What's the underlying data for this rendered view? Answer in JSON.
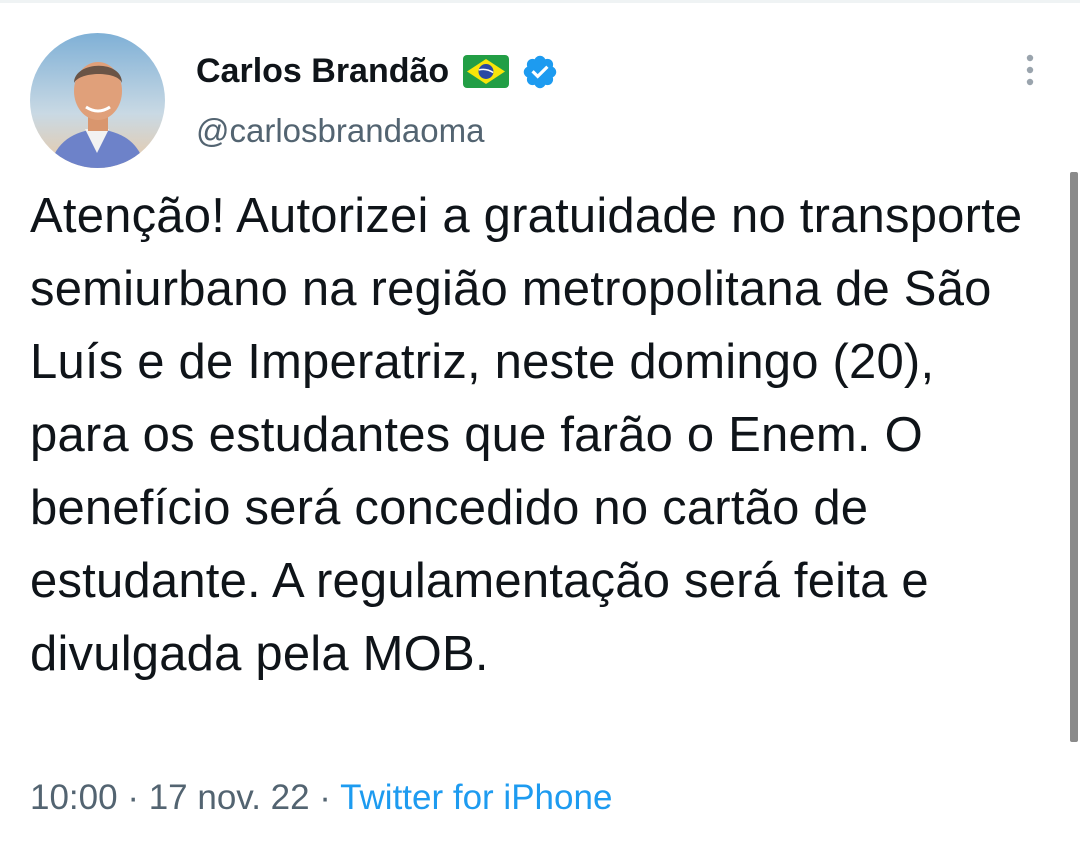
{
  "author": {
    "name": "Carlos Brandão",
    "handle": "@carlosbrandaoma"
  },
  "tweet": {
    "text": "Atenção! Autorizei a gratuidade no transporte semiurbano na região metropolitana de São Luís e de Imperatriz, neste domingo (20), para os estudantes que farão o Enem. O benefício será concedido no cartão de estudante. A regulamentação será feita e divulgada pela MOB.",
    "time": "10:00",
    "separator": " · ",
    "date": "17 nov. 22",
    "source": "Twitter for iPhone"
  },
  "icons": {
    "avatar": "avatar-photo",
    "flag": "brazil-flag-icon",
    "verified": "verified-badge-icon",
    "more": "more-options-icon"
  },
  "colors": {
    "text": "#0f1419",
    "secondary": "#536471",
    "accent": "#1d9bf0"
  }
}
